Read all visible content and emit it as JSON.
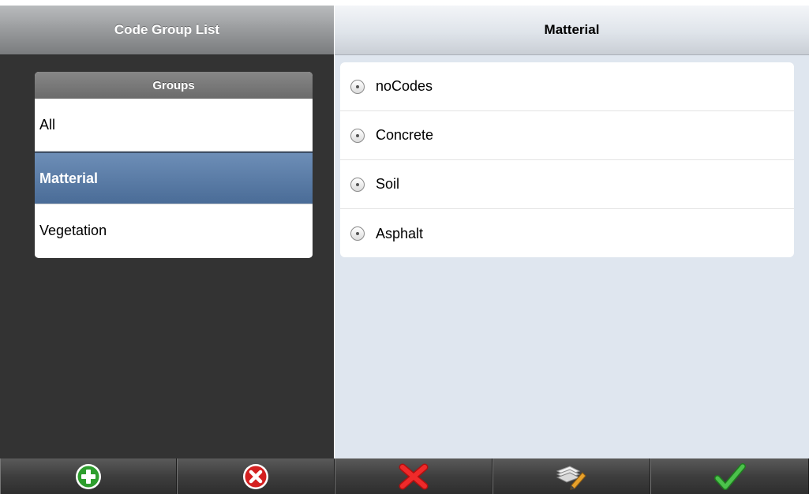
{
  "left_pane": {
    "header_title": "Code Group List",
    "groups_title": "Groups",
    "groups": [
      {
        "label": "All",
        "selected": false
      },
      {
        "label": "Matterial",
        "selected": true
      },
      {
        "label": "Vegetation",
        "selected": false
      }
    ]
  },
  "right_pane": {
    "header_title": "Matterial",
    "codes": [
      {
        "label": "noCodes",
        "icon": "radio-icon"
      },
      {
        "label": "Concrete",
        "icon": "radio-icon"
      },
      {
        "label": "Soil",
        "icon": "radio-icon"
      },
      {
        "label": "Asphalt",
        "icon": "radio-icon"
      }
    ]
  },
  "toolbar": {
    "buttons": [
      {
        "name": "add-group-button",
        "icon": "plus-circle-icon",
        "color": "#2e9e2e"
      },
      {
        "name": "delete-group-button",
        "icon": "x-circle-icon",
        "color": "#d42020"
      },
      {
        "name": "cancel-button",
        "icon": "red-x-icon",
        "color": "#e01b1b"
      },
      {
        "name": "edit-button",
        "icon": "pages-pencil-icon",
        "color": "#e8a12a"
      },
      {
        "name": "confirm-button",
        "icon": "green-check-icon",
        "color": "#3aa53a"
      }
    ]
  },
  "colors": {
    "selected_row": "#5a7ca6",
    "left_background": "#333333",
    "right_background": "#dfe6ef"
  }
}
